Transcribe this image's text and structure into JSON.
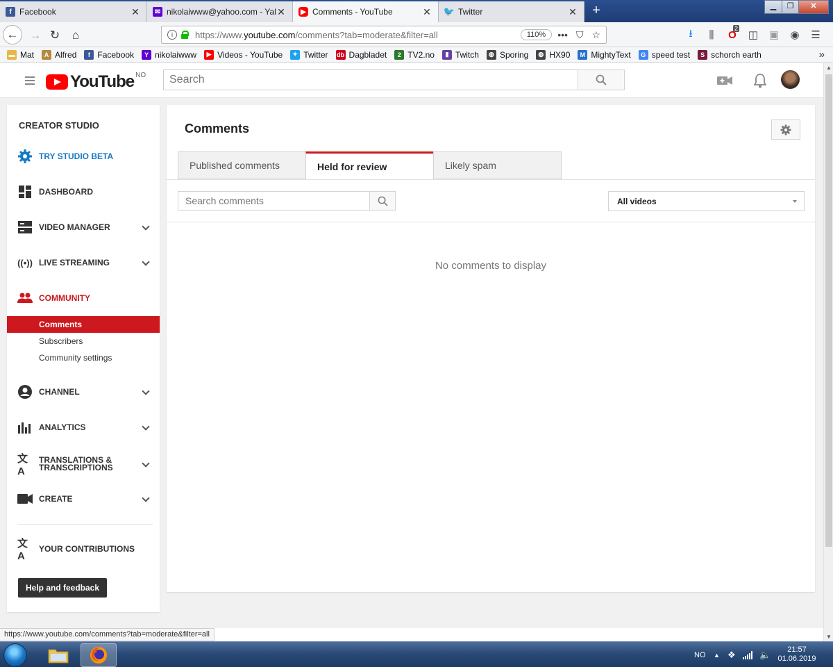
{
  "browser": {
    "tabs": [
      {
        "title": "Facebook",
        "icon": "facebook-icon",
        "active": false
      },
      {
        "title": "nikolaiwww@yahoo.com - Yah",
        "icon": "yahoo-mail-icon",
        "active": false
      },
      {
        "title": "Comments - YouTube",
        "icon": "youtube-icon",
        "active": true
      },
      {
        "title": "Twitter",
        "icon": "twitter-icon",
        "active": false
      }
    ],
    "url_prefix": "https://www.",
    "url_domain": "youtube.com",
    "url_path": "/comments?tab=moderate&filter=all",
    "zoom": "110%",
    "notification_count": "2",
    "bookmarks": [
      {
        "label": "Mat",
        "icon": "folder-icon",
        "color": "#e6b84a"
      },
      {
        "label": "Alfred",
        "icon": "alfred-icon",
        "color": "#b58a3c"
      },
      {
        "label": "Facebook",
        "icon": "facebook-icon",
        "color": "#3b5998"
      },
      {
        "label": "nikolaiwww",
        "icon": "yahoo-icon",
        "color": "#6001d2"
      },
      {
        "label": "Videos - YouTube",
        "icon": "youtube-icon",
        "color": "#ff0000"
      },
      {
        "label": "Twitter",
        "icon": "twitter-icon",
        "color": "#1da1f2"
      },
      {
        "label": "Dagbladet",
        "icon": "dagbladet-icon",
        "color": "#d0021b"
      },
      {
        "label": "TV2.no",
        "icon": "tv2-icon",
        "color": "#2a7a2a"
      },
      {
        "label": "Twitch",
        "icon": "twitch-icon",
        "color": "#6441a5"
      },
      {
        "label": "Sporing",
        "icon": "globe-icon",
        "color": "#444444"
      },
      {
        "label": "HX90",
        "icon": "globe-icon",
        "color": "#444444"
      },
      {
        "label": "MightyText",
        "icon": "mightytext-icon",
        "color": "#2a6fd0"
      },
      {
        "label": "speed test",
        "icon": "google-icon",
        "color": "#4285f4"
      },
      {
        "label": "schorch earth",
        "icon": "schorch-icon",
        "color": "#7a1a3a"
      }
    ],
    "status_url": "https://www.youtube.com/comments?tab=moderate&filter=all"
  },
  "youtube": {
    "logo_text": "YouTube",
    "region": "NO",
    "search_placeholder": "Search"
  },
  "sidebar": {
    "heading": "CREATOR STUDIO",
    "items": [
      {
        "label": "TRY STUDIO BETA",
        "icon": "gear-icon",
        "style": "blue",
        "chevron": false
      },
      {
        "label": "DASHBOARD",
        "icon": "dashboard-icon",
        "style": "normal",
        "chevron": false
      },
      {
        "label": "VIDEO MANAGER",
        "icon": "video-manager-icon",
        "style": "normal",
        "chevron": true
      },
      {
        "label": "LIVE STREAMING",
        "icon": "live-streaming-icon",
        "style": "normal",
        "chevron": true
      },
      {
        "label": "COMMUNITY",
        "icon": "community-icon",
        "style": "red",
        "chevron": false
      },
      {
        "label": "CHANNEL",
        "icon": "channel-icon",
        "style": "normal",
        "chevron": true
      },
      {
        "label": "ANALYTICS",
        "icon": "analytics-icon",
        "style": "normal",
        "chevron": true
      },
      {
        "label": "TRANSLATIONS & TRANSCRIPTIONS",
        "icon": "translate-icon",
        "style": "normal",
        "chevron": true
      },
      {
        "label": "CREATE",
        "icon": "video-camera-icon",
        "style": "normal",
        "chevron": true
      },
      {
        "label": "YOUR CONTRIBUTIONS",
        "icon": "translate-icon",
        "style": "normal",
        "chevron": false
      }
    ],
    "community_sub": [
      "Comments",
      "Subscribers",
      "Community settings"
    ],
    "help_button": "Help and feedback"
  },
  "main": {
    "title": "Comments",
    "tabs": [
      "Published comments",
      "Held for review",
      "Likely spam"
    ],
    "active_tab": "Held for review",
    "search_placeholder": "Search comments",
    "video_filter": "All videos",
    "empty_message": "No comments to display"
  },
  "taskbar": {
    "language": "NO",
    "time": "21:57",
    "date": "01.06.2019"
  },
  "colors": {
    "youtube_red": "#cc181e",
    "studio_blue": "#167ac6"
  }
}
